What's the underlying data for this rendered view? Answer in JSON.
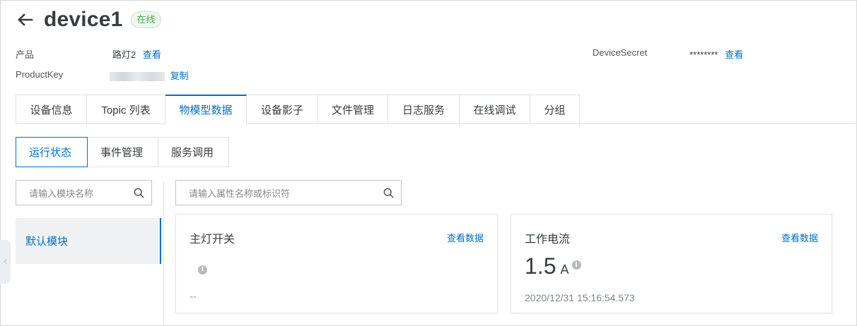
{
  "header": {
    "title": "device1",
    "status": "在线"
  },
  "meta": {
    "product_label": "产品",
    "product_value": "路灯2",
    "product_link": "查看",
    "productkey_label": "ProductKey",
    "productkey_link": "复制",
    "secret_label": "DeviceSecret",
    "secret_value": "********",
    "secret_link": "查看"
  },
  "tabs": [
    {
      "label": "设备信息"
    },
    {
      "label": "Topic 列表"
    },
    {
      "label": "物模型数据"
    },
    {
      "label": "设备影子"
    },
    {
      "label": "文件管理"
    },
    {
      "label": "日志服务"
    },
    {
      "label": "在线调试"
    },
    {
      "label": "分组"
    }
  ],
  "active_tab": "物模型数据",
  "subtabs": [
    {
      "label": "运行状态"
    },
    {
      "label": "事件管理"
    },
    {
      "label": "服务调用"
    }
  ],
  "module_search": {
    "placeholder": "请输入模块名称"
  },
  "property_search": {
    "placeholder": "请输入属性名称或标识符"
  },
  "modules": [
    {
      "label": "默认模块"
    }
  ],
  "cards": [
    {
      "title": "主灯开关",
      "link": "查看数据",
      "value": "",
      "unit": "",
      "time": "--"
    },
    {
      "title": "工作电流",
      "link": "查看数据",
      "value": "1.5",
      "unit": "A",
      "time": "2020/12/31 15:16:54.573"
    }
  ],
  "icons": [
    "back-arrow-icon",
    "search-icon",
    "info-icon",
    "chevron-left-icon"
  ],
  "colors": {
    "accent": "#0070cc",
    "status_green": "#4caf50",
    "text": "#373d41"
  }
}
